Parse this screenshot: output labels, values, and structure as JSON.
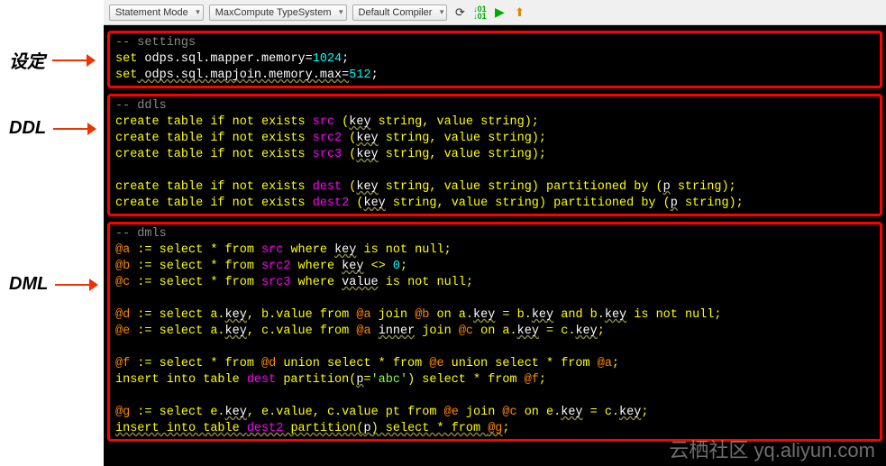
{
  "toolbar": {
    "statement_mode": "Statement Mode",
    "typesystem": "MaxCompute TypeSystem",
    "compiler": "Default Compiler"
  },
  "labels": {
    "settings": "设定",
    "ddl": "DDL",
    "dml": "DML"
  },
  "code": {
    "settings": {
      "comment": "-- settings",
      "l1a": "set",
      "l1b": " odps.sql.mapper.memory=",
      "l1c": "1024",
      "l1d": ";",
      "l2a": "set",
      "l2b": " odps.sql.mapjoin.memory.max=",
      "l2c": "512",
      "l2d": ";"
    },
    "ddl": {
      "comment": "-- ddls",
      "l1a": "create table if not exists ",
      "l1b": "src",
      "l1c": " (",
      "l1d": "key",
      "l1e": " string, value string);",
      "l2a": "create table if not exists ",
      "l2b": "src2",
      "l2c": " (",
      "l2d": "key",
      "l2e": " string, value string);",
      "l3a": "create table if not exists ",
      "l3b": "src3",
      "l3c": " (",
      "l3d": "key",
      "l3e": " string, value string);",
      "l4a": "create table if not exists ",
      "l4b": "dest",
      "l4c": " (",
      "l4d": "key",
      "l4e": " string, value string) partitioned by (",
      "l4f": "p",
      "l4g": " string);",
      "l5a": "create table if not exists ",
      "l5b": "dest2",
      "l5c": " (",
      "l5d": "key",
      "l5e": " string, value string) partitioned by (",
      "l5f": "p",
      "l5g": " string);"
    },
    "dml": {
      "comment": "-- dmls",
      "l1a": "@a",
      "l1b": " := select * from ",
      "l1c": "src",
      "l1d": " where ",
      "l1e": "key",
      "l1f": " is not null;",
      "l2a": "@b",
      "l2b": " := select * from ",
      "l2c": "src2",
      "l2d": " where ",
      "l2e": "key",
      "l2f": " <> ",
      "l2g": "0",
      "l2h": ";",
      "l3a": "@c",
      "l3b": " := select * from ",
      "l3c": "src3",
      "l3d": " where ",
      "l3e": "value",
      "l3f": " is not null;",
      "l4a": "@d",
      "l4b": " := select a.",
      "l4c": "key",
      "l4d": ", b.value from ",
      "l4e": "@a",
      "l4f": " join ",
      "l4g": "@b",
      "l4h": " on a.",
      "l4i": "key",
      "l4j": " = b.",
      "l4k": "key",
      "l4l": " and b.",
      "l4m": "key",
      "l4n": " is not null;",
      "l5a": "@e",
      "l5b": " := select a.",
      "l5c": "key",
      "l5d": ", c.value from ",
      "l5e": "@a",
      "l5f": " ",
      "l5g": "inner",
      "l5h": " join ",
      "l5i": "@c",
      "l5j": " on a.",
      "l5k": "key",
      "l5l": " = c.",
      "l5m": "key",
      "l5n": ";",
      "l6a": "@f",
      "l6b": " := select * from ",
      "l6c": "@d",
      "l6d": " union select * from ",
      "l6e": "@e",
      "l6f": " union select * from ",
      "l6g": "@a",
      "l6h": ";",
      "l7a": "insert into table ",
      "l7b": "dest",
      "l7c": " partition(",
      "l7d": "p",
      "l7e": "=",
      "l7f": "'abc'",
      "l7g": ") select * from ",
      "l7h": "@f",
      "l7i": ";",
      "l8a": "@g",
      "l8b": " := select e.",
      "l8c": "key",
      "l8d": ", e.value, c.value pt from ",
      "l8e": "@e",
      "l8f": " join ",
      "l8g": "@c",
      "l8h": " on e.",
      "l8i": "key",
      "l8j": " = c.",
      "l8k": "key",
      "l8l": ";",
      "l9a": "insert into table ",
      "l9b": "dest2",
      "l9c": " partition(",
      "l9d": "p",
      "l9e": ") select * from ",
      "l9f": "@g",
      "l9g": ";"
    }
  },
  "watermark": "云栖社区  yq.aliyun.com"
}
